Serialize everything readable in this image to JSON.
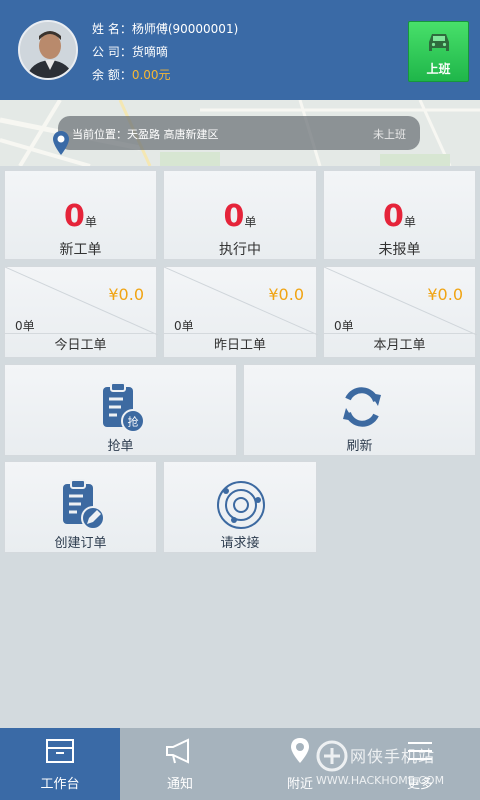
{
  "profile": {
    "name_label": "姓 名：杨师傅(90000001)",
    "company_label": "公 司：货嘀嘀",
    "balance_prefix": "余 额：",
    "balance_value": "0.00元"
  },
  "duty_button": {
    "label": "上班"
  },
  "location": {
    "text": "当前位置：天盈路   高唐新建区",
    "status": "未上班"
  },
  "stats": [
    {
      "count": "0",
      "unit": "单",
      "label": "新工单"
    },
    {
      "count": "0",
      "unit": "单",
      "label": "执行中"
    },
    {
      "count": "0",
      "unit": "单",
      "label": "未报单"
    }
  ],
  "earnings": [
    {
      "amount": "¥0.0",
      "orders": "0单",
      "label": "今日工单"
    },
    {
      "amount": "¥0.0",
      "orders": "0单",
      "label": "昨日工单"
    },
    {
      "amount": "¥0.0",
      "orders": "0单",
      "label": "本月工单"
    }
  ],
  "actions": {
    "grab": {
      "label": "抢单",
      "badge": "抢",
      "icon": "clipboard-grab-icon"
    },
    "refresh": {
      "label": "刷新",
      "icon": "refresh-icon"
    },
    "create": {
      "label": "创建订单",
      "icon": "clipboard-edit-icon"
    },
    "request": {
      "label": "请求接",
      "icon": "radar-icon"
    }
  },
  "nav": [
    {
      "label": "工作台",
      "icon": "inbox-icon",
      "active": true
    },
    {
      "label": "通知",
      "icon": "megaphone-icon",
      "active": false
    },
    {
      "label": "附近",
      "icon": "location-pin-icon",
      "active": false
    },
    {
      "label": "更多",
      "icon": "menu-icon",
      "active": false
    }
  ],
  "watermark": {
    "text": "网侠手机站",
    "url": "WWW.HACKHOME.COM"
  },
  "colors": {
    "header_bg": "#3a6aa6",
    "duty_green": "#2fc255",
    "count_red": "#e5243a",
    "amount_orange": "#f0a414",
    "icon_blue": "#3d6aa1",
    "nav_bg": "#a6b3bd"
  }
}
